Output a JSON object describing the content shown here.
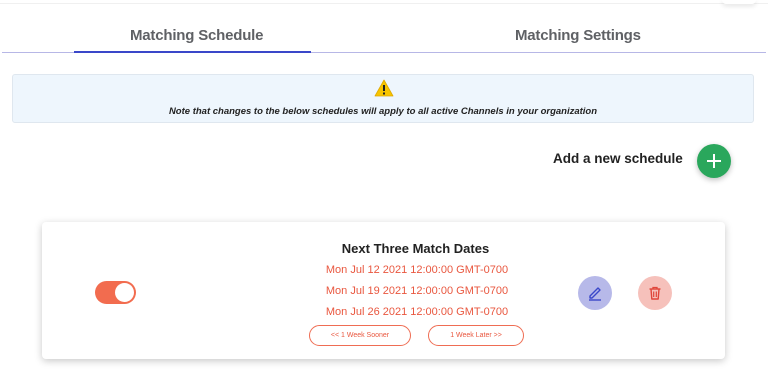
{
  "tabs": [
    {
      "label": "Matching Schedule",
      "active": true
    },
    {
      "label": "Matching Settings",
      "active": false
    }
  ],
  "notice": {
    "icon": "warning-icon",
    "text": "Note that changes to the below schedules will apply to all active Channels in your organization"
  },
  "add_schedule": {
    "label": "Add a new schedule",
    "icon": "plus-icon"
  },
  "schedule_card": {
    "title": "Next Three Match Dates",
    "enabled": true,
    "dates": [
      "Mon Jul 12 2021 12:00:00 GMT-0700",
      "Mon Jul 19 2021 12:00:00 GMT-0700",
      "Mon Jul 26 2021 12:00:00 GMT-0700"
    ],
    "sooner_label": "<< 1 Week Sooner",
    "later_label": "1 Week Later >>",
    "edit_icon": "pencil-icon",
    "delete_icon": "trash-icon"
  },
  "colors": {
    "accent": "#3a47c9",
    "add_button": "#2aa75c",
    "toggle_on": "#f26c4f",
    "date_text": "#e9573f",
    "edit_button": "#b7b9e9",
    "delete_button": "#f6c1bb",
    "notice_bg": "#eef6fd"
  }
}
